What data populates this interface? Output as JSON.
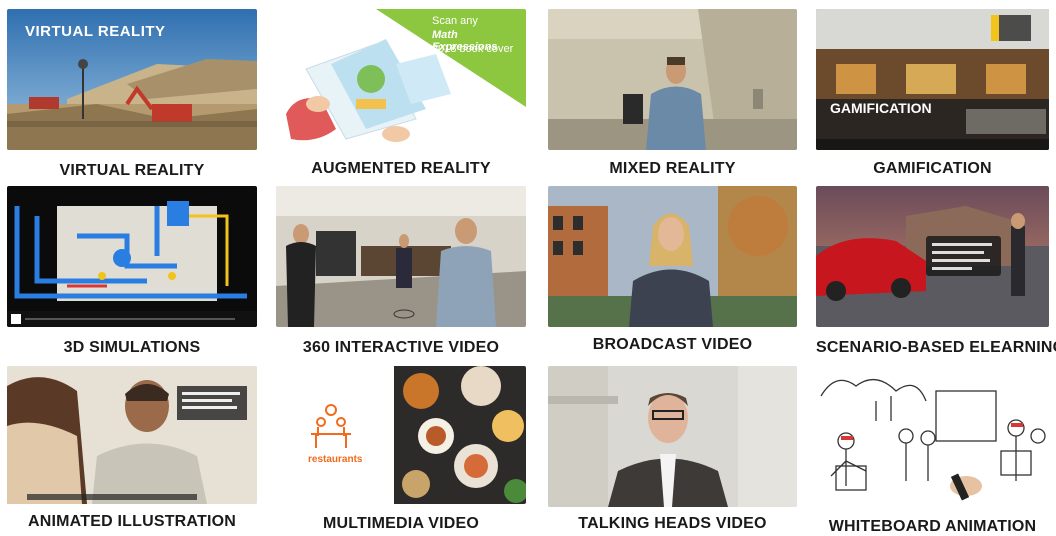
{
  "tiles": [
    {
      "id": "virtual-reality",
      "caption": "VIRTUAL REALITY",
      "overlay": "VIRTUAL REALITY"
    },
    {
      "id": "augmented-reality",
      "caption": "AUGMENTED REALITY",
      "overlay_line1": "Scan any",
      "overlay_line2": "Math Expressions",
      "overlay_line3": "2018 book cover"
    },
    {
      "id": "mixed-reality",
      "caption": "MIXED REALITY"
    },
    {
      "id": "gamification",
      "caption": "GAMIFICATION",
      "overlay": "GAMIFICATION"
    },
    {
      "id": "3d-simulations",
      "caption": "3D SIMULATIONS"
    },
    {
      "id": "360-interactive-video",
      "caption": "360 INTERACTIVE VIDEO"
    },
    {
      "id": "broadcast-video",
      "caption": "BROADCAST VIDEO"
    },
    {
      "id": "scenario-based-elearning",
      "caption": "SCENARIO-BASED ELEARNING"
    },
    {
      "id": "animated-illustration",
      "caption": "ANIMATED ILLUSTRATION"
    },
    {
      "id": "multimedia-video",
      "caption": "MULTIMEDIA VIDEO",
      "overlay": "restaurants"
    },
    {
      "id": "talking-heads-video",
      "caption": "TALKING HEADS VIDEO"
    },
    {
      "id": "whiteboard-animation",
      "caption": "WHITEBOARD ANIMATION"
    }
  ],
  "colors": {
    "caption_text": "#1a1a1a",
    "ar_green": "#8dc63f",
    "restaurant_orange": "#f26b1d",
    "sim_pipe_blue": "#2a7de1",
    "sim_pipe_yellow": "#f2c31b",
    "car_red": "#c8161e"
  }
}
